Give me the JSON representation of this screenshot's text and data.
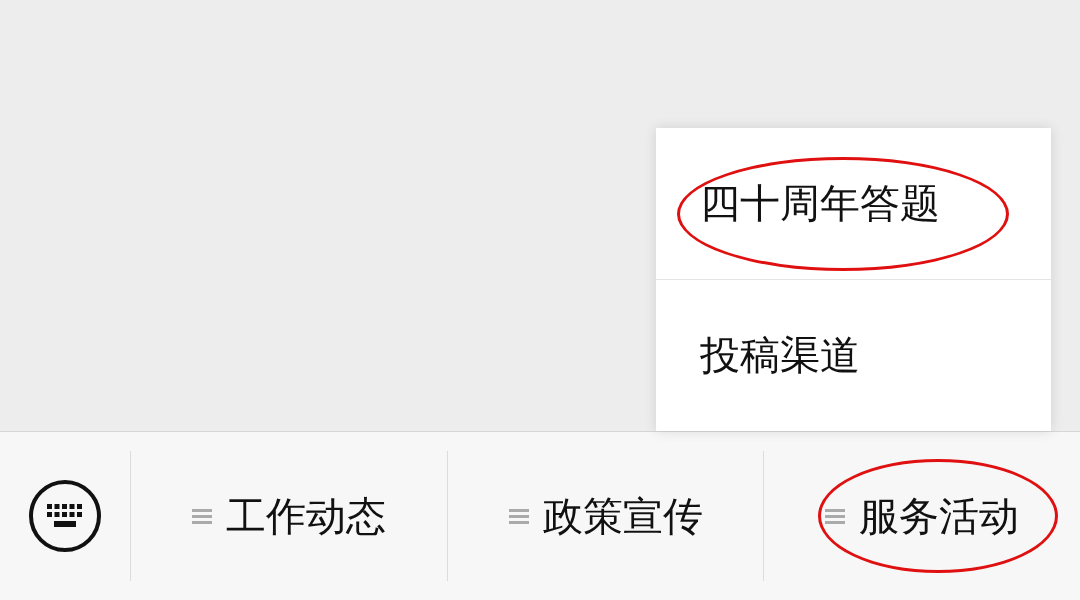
{
  "popup_menu": {
    "items": [
      {
        "label": "四十周年答题",
        "circled": true
      },
      {
        "label": "投稿渠道",
        "circled": false
      }
    ]
  },
  "bottom_menu": {
    "items": [
      {
        "label": "工作动态",
        "circled": false
      },
      {
        "label": "政策宣传",
        "circled": false
      },
      {
        "label": "服务活动",
        "circled": true
      }
    ]
  }
}
